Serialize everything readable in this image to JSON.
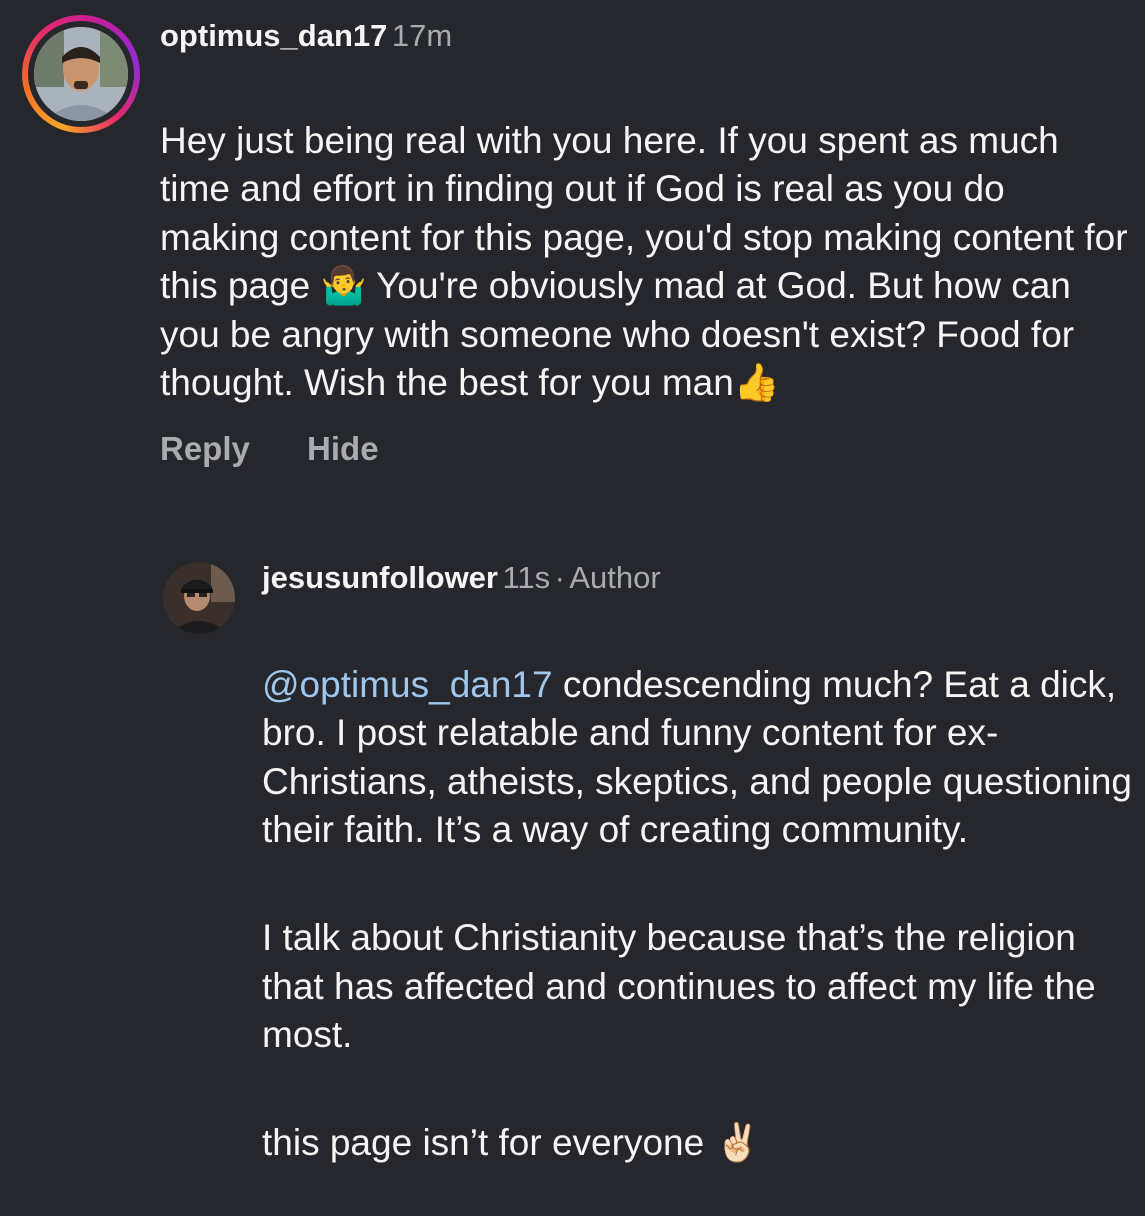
{
  "comments": [
    {
      "username": "optimus_dan17",
      "time": "17m",
      "lines": [
        "Hey just being real with you here. If you spent as much time and effort in finding out if God is real as you do making content for this page, you'd stop making content for this page 🤷‍♂️ You're obviously mad at God. But how can you be angry with someone who doesn't exist? Food for thought. Wish the best for you man👍"
      ],
      "actions": {
        "reply": "Reply",
        "hide": "Hide"
      }
    },
    {
      "username": "jesusunfollower",
      "time": "11s",
      "separator": "·",
      "role": "Author",
      "mention": "@optimus_dan17",
      "paragraph1": " condescending much? Eat a dick, bro. I post relatable and funny content for ex-Christians, atheists, skeptics, and people questioning their faith. It’s a way of creating community.",
      "paragraph2": "I talk about Christianity because that’s the religion that has affected and continues to affect my life the most.",
      "paragraph3": "this page isn’t for everyone ✌🏻"
    }
  ]
}
